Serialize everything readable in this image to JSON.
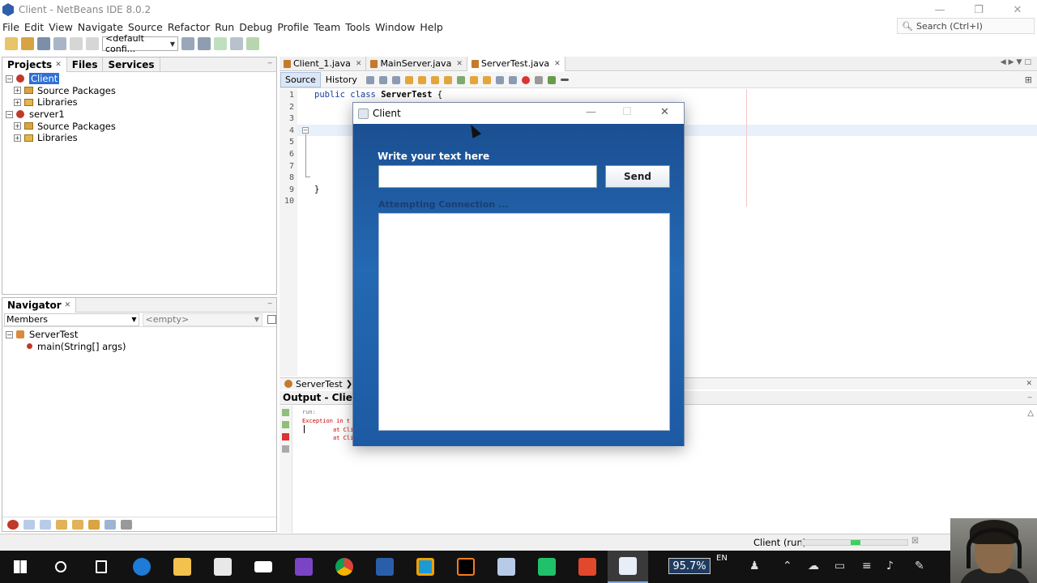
{
  "window": {
    "title": "Client - NetBeans IDE 8.0.2",
    "minimize": "—",
    "restore": "❐",
    "close": "✕"
  },
  "menu": [
    "File",
    "Edit",
    "View",
    "Navigate",
    "Source",
    "Refactor",
    "Run",
    "Debug",
    "Profile",
    "Team",
    "Tools",
    "Window",
    "Help"
  ],
  "search": {
    "placeholder": "Search (Ctrl+I)"
  },
  "toolbar": {
    "config": "<default confi..."
  },
  "projects_panel": {
    "tabs": [
      "Projects",
      "Files",
      "Services"
    ],
    "tree": [
      {
        "label": "Client",
        "level": 0,
        "type": "project",
        "selected": true
      },
      {
        "label": "Source Packages",
        "level": 1,
        "type": "package"
      },
      {
        "label": "Libraries",
        "level": 1,
        "type": "library"
      },
      {
        "label": "server1",
        "level": 0,
        "type": "project"
      },
      {
        "label": "Source Packages",
        "level": 1,
        "type": "package"
      },
      {
        "label": "Libraries",
        "level": 1,
        "type": "library"
      }
    ]
  },
  "navigator": {
    "title": "Navigator",
    "members": "Members",
    "filter": "<empty>",
    "class_name": "ServerTest",
    "method": "main(String[] args)"
  },
  "editor": {
    "tabs": [
      {
        "label": "Client_1.java",
        "active": false
      },
      {
        "label": "MainServer.java",
        "active": false
      },
      {
        "label": "ServerTest.java",
        "active": true
      }
    ],
    "source_label": "Source",
    "history_label": "History",
    "line_numbers": [
      "1",
      "2",
      "3",
      "4",
      "5",
      "6",
      "7",
      "8",
      "9",
      "10"
    ],
    "code_line_1": {
      "kw1": "public",
      "kw2": "class",
      "name": "ServerTest",
      "brace": "{"
    },
    "code_line_9": "}",
    "breadcrumb": "ServerTest"
  },
  "output": {
    "title": "Output - Client (",
    "lines": [
      "run:",
      "Exception in t",
      "at Cli",
      "at Cli"
    ]
  },
  "status": {
    "run_label": "Client (run)",
    "progress": 0.5
  },
  "client_app": {
    "title": "Client",
    "prompt": "Write your text here",
    "input_value": "",
    "send_label": "Send",
    "status": "Attempting Connection ..."
  },
  "taskbar": {
    "zoom": "95.7%",
    "lang": "EN"
  }
}
